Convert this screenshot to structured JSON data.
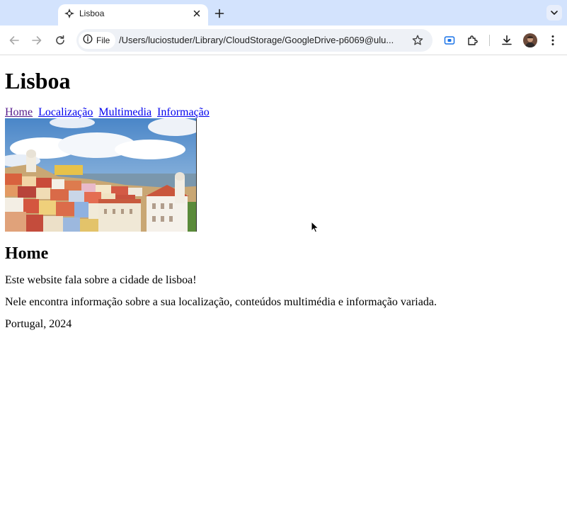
{
  "browser": {
    "tab": {
      "title": "Lisboa"
    },
    "address_bar": {
      "chip_label": "File",
      "url": "/Users/luciostuder/Library/CloudStorage/GoogleDrive-p6069@ulu..."
    }
  },
  "page": {
    "title": "Lisboa",
    "nav": [
      {
        "label": "Home"
      },
      {
        "label": "Localização"
      },
      {
        "label": "Multimedia"
      },
      {
        "label": "Informação"
      }
    ],
    "section_title": "Home",
    "paragraphs": [
      "Este website fala sobre a cidade de lisboa!",
      "Nele encontra informação sobre a sua localização, conteúdos multimédia e informação variada.",
      "Portugal, 2024"
    ]
  },
  "colors": {
    "tabstrip_bg": "#d3e3fd",
    "link": "#0000ee",
    "visited_link": "#551a8b"
  }
}
